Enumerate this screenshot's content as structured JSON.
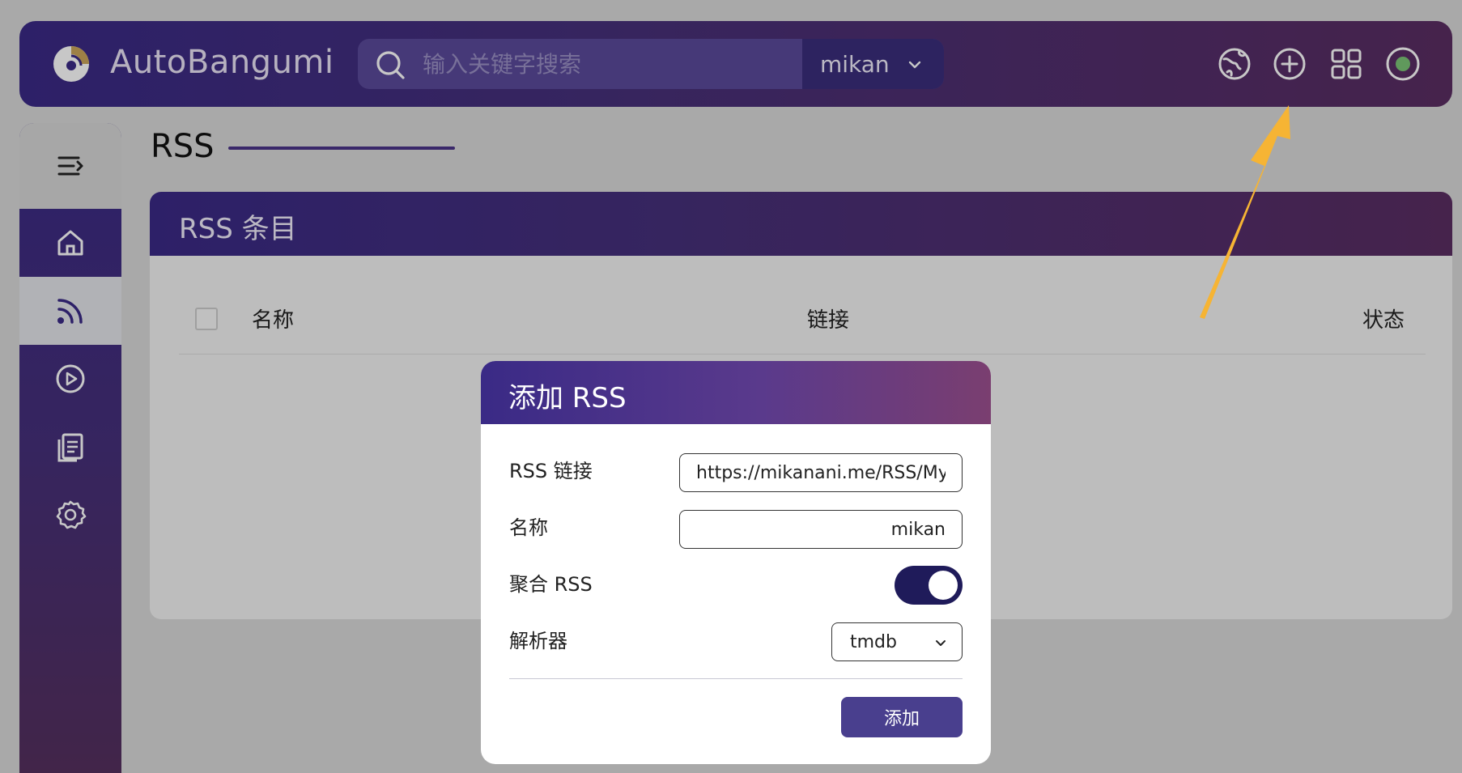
{
  "header": {
    "app_title": "AutoBangumi",
    "search_placeholder": "输入关键字搜索",
    "source_selected": "mikan",
    "icons": [
      "globe-icon",
      "add-circle-icon",
      "apps-grid-icon",
      "status-dot-icon"
    ]
  },
  "sidebar": {
    "items": [
      {
        "icon": "menu-toggle-icon"
      },
      {
        "icon": "home-icon"
      },
      {
        "icon": "rss-icon",
        "active": true
      },
      {
        "icon": "play-circle-icon"
      },
      {
        "icon": "log-icon"
      },
      {
        "icon": "settings-icon"
      }
    ]
  },
  "page": {
    "title": "RSS"
  },
  "card": {
    "title": "RSS 条目",
    "columns": [
      "名称",
      "链接",
      "状态"
    ]
  },
  "dialog": {
    "title": "添加 RSS",
    "rss_link_label": "RSS 链接",
    "rss_link_value": "https://mikanani.me/RSS/MyBangumi",
    "name_label": "名称",
    "name_value": "mikan",
    "aggregate_label": "聚合 RSS",
    "aggregate_on": true,
    "parser_label": "解析器",
    "parser_value": "tmdb",
    "add_label": "添加"
  },
  "colors": {
    "brand_start": "#3a2a86",
    "brand_end": "#5a2d62",
    "arrow": "#f6b434",
    "status_green": "#7cc576"
  }
}
